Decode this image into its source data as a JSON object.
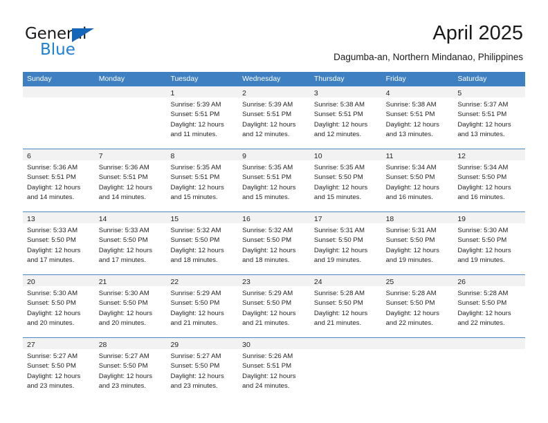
{
  "brand": {
    "name_top": "General",
    "name_bottom": "Blue",
    "accent_color": "#1f7fd4",
    "triangle_color": "#1565b8"
  },
  "header": {
    "title": "April 2025",
    "subtitle": "Dagumba-an, Northern Mindanao, Philippines"
  },
  "calendar": {
    "header_bg": "#3f80c3",
    "day_band_bg": "#f2f2f2",
    "weekdays": [
      "Sunday",
      "Monday",
      "Tuesday",
      "Wednesday",
      "Thursday",
      "Friday",
      "Saturday"
    ],
    "weeks": [
      [
        {
          "empty": true
        },
        {
          "empty": true
        },
        {
          "day": "1",
          "lines": [
            "Sunrise: 5:39 AM",
            "Sunset: 5:51 PM",
            "Daylight: 12 hours",
            "and 11 minutes."
          ]
        },
        {
          "day": "2",
          "lines": [
            "Sunrise: 5:39 AM",
            "Sunset: 5:51 PM",
            "Daylight: 12 hours",
            "and 12 minutes."
          ]
        },
        {
          "day": "3",
          "lines": [
            "Sunrise: 5:38 AM",
            "Sunset: 5:51 PM",
            "Daylight: 12 hours",
            "and 12 minutes."
          ]
        },
        {
          "day": "4",
          "lines": [
            "Sunrise: 5:38 AM",
            "Sunset: 5:51 PM",
            "Daylight: 12 hours",
            "and 13 minutes."
          ]
        },
        {
          "day": "5",
          "lines": [
            "Sunrise: 5:37 AM",
            "Sunset: 5:51 PM",
            "Daylight: 12 hours",
            "and 13 minutes."
          ]
        }
      ],
      [
        {
          "day": "6",
          "lines": [
            "Sunrise: 5:36 AM",
            "Sunset: 5:51 PM",
            "Daylight: 12 hours",
            "and 14 minutes."
          ]
        },
        {
          "day": "7",
          "lines": [
            "Sunrise: 5:36 AM",
            "Sunset: 5:51 PM",
            "Daylight: 12 hours",
            "and 14 minutes."
          ]
        },
        {
          "day": "8",
          "lines": [
            "Sunrise: 5:35 AM",
            "Sunset: 5:51 PM",
            "Daylight: 12 hours",
            "and 15 minutes."
          ]
        },
        {
          "day": "9",
          "lines": [
            "Sunrise: 5:35 AM",
            "Sunset: 5:51 PM",
            "Daylight: 12 hours",
            "and 15 minutes."
          ]
        },
        {
          "day": "10",
          "lines": [
            "Sunrise: 5:35 AM",
            "Sunset: 5:50 PM",
            "Daylight: 12 hours",
            "and 15 minutes."
          ]
        },
        {
          "day": "11",
          "lines": [
            "Sunrise: 5:34 AM",
            "Sunset: 5:50 PM",
            "Daylight: 12 hours",
            "and 16 minutes."
          ]
        },
        {
          "day": "12",
          "lines": [
            "Sunrise: 5:34 AM",
            "Sunset: 5:50 PM",
            "Daylight: 12 hours",
            "and 16 minutes."
          ]
        }
      ],
      [
        {
          "day": "13",
          "lines": [
            "Sunrise: 5:33 AM",
            "Sunset: 5:50 PM",
            "Daylight: 12 hours",
            "and 17 minutes."
          ]
        },
        {
          "day": "14",
          "lines": [
            "Sunrise: 5:33 AM",
            "Sunset: 5:50 PM",
            "Daylight: 12 hours",
            "and 17 minutes."
          ]
        },
        {
          "day": "15",
          "lines": [
            "Sunrise: 5:32 AM",
            "Sunset: 5:50 PM",
            "Daylight: 12 hours",
            "and 18 minutes."
          ]
        },
        {
          "day": "16",
          "lines": [
            "Sunrise: 5:32 AM",
            "Sunset: 5:50 PM",
            "Daylight: 12 hours",
            "and 18 minutes."
          ]
        },
        {
          "day": "17",
          "lines": [
            "Sunrise: 5:31 AM",
            "Sunset: 5:50 PM",
            "Daylight: 12 hours",
            "and 19 minutes."
          ]
        },
        {
          "day": "18",
          "lines": [
            "Sunrise: 5:31 AM",
            "Sunset: 5:50 PM",
            "Daylight: 12 hours",
            "and 19 minutes."
          ]
        },
        {
          "day": "19",
          "lines": [
            "Sunrise: 5:30 AM",
            "Sunset: 5:50 PM",
            "Daylight: 12 hours",
            "and 19 minutes."
          ]
        }
      ],
      [
        {
          "day": "20",
          "lines": [
            "Sunrise: 5:30 AM",
            "Sunset: 5:50 PM",
            "Daylight: 12 hours",
            "and 20 minutes."
          ]
        },
        {
          "day": "21",
          "lines": [
            "Sunrise: 5:30 AM",
            "Sunset: 5:50 PM",
            "Daylight: 12 hours",
            "and 20 minutes."
          ]
        },
        {
          "day": "22",
          "lines": [
            "Sunrise: 5:29 AM",
            "Sunset: 5:50 PM",
            "Daylight: 12 hours",
            "and 21 minutes."
          ]
        },
        {
          "day": "23",
          "lines": [
            "Sunrise: 5:29 AM",
            "Sunset: 5:50 PM",
            "Daylight: 12 hours",
            "and 21 minutes."
          ]
        },
        {
          "day": "24",
          "lines": [
            "Sunrise: 5:28 AM",
            "Sunset: 5:50 PM",
            "Daylight: 12 hours",
            "and 21 minutes."
          ]
        },
        {
          "day": "25",
          "lines": [
            "Sunrise: 5:28 AM",
            "Sunset: 5:50 PM",
            "Daylight: 12 hours",
            "and 22 minutes."
          ]
        },
        {
          "day": "26",
          "lines": [
            "Sunrise: 5:28 AM",
            "Sunset: 5:50 PM",
            "Daylight: 12 hours",
            "and 22 minutes."
          ]
        }
      ],
      [
        {
          "day": "27",
          "lines": [
            "Sunrise: 5:27 AM",
            "Sunset: 5:50 PM",
            "Daylight: 12 hours",
            "and 23 minutes."
          ]
        },
        {
          "day": "28",
          "lines": [
            "Sunrise: 5:27 AM",
            "Sunset: 5:50 PM",
            "Daylight: 12 hours",
            "and 23 minutes."
          ]
        },
        {
          "day": "29",
          "lines": [
            "Sunrise: 5:27 AM",
            "Sunset: 5:50 PM",
            "Daylight: 12 hours",
            "and 23 minutes."
          ]
        },
        {
          "day": "30",
          "lines": [
            "Sunrise: 5:26 AM",
            "Sunset: 5:51 PM",
            "Daylight: 12 hours",
            "and 24 minutes."
          ]
        },
        {
          "empty": true
        },
        {
          "empty": true
        },
        {
          "empty": true
        }
      ]
    ]
  }
}
